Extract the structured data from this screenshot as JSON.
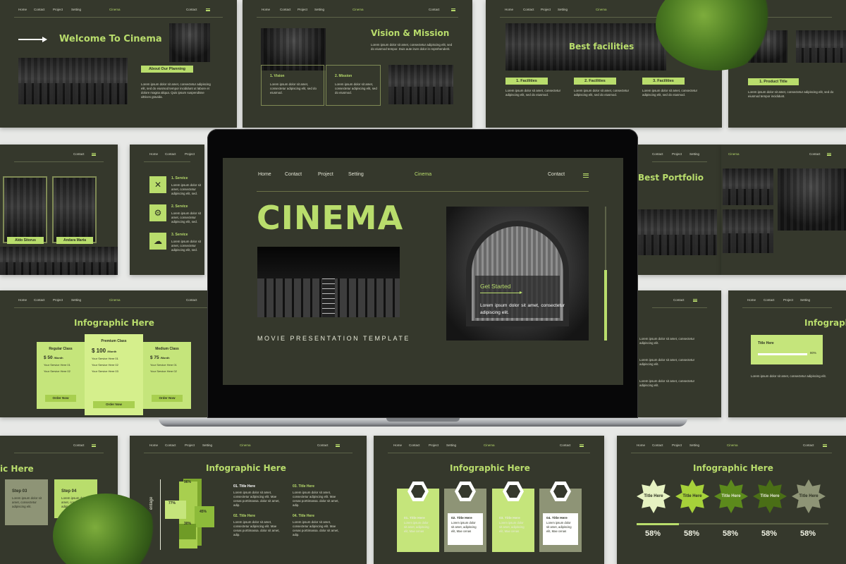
{
  "nav": {
    "home": "Home",
    "contact": "Contact",
    "project": "Project",
    "setting": "Setting",
    "brand": "Cinema",
    "contact_right": "Contact"
  },
  "slide_welcome": {
    "title": "Welcome To Cinema",
    "label": "About Our Planning",
    "text": "Lorem ipsum dolor sit amet, consectetur adipiscing elit, sed do eiusmod tempor incididunt ut labore et dolore magna aliqua. Quis ipsum suspendisse ultrices gravida."
  },
  "slide_vision": {
    "title": "Vision & Mission",
    "intro": "Lorem ipsum dolor sit amet, consectetur adipiscing elit, sed do eiusmod tempor. Duis aute irure dolor in reprehenderit.",
    "box1_title": "1. Vision",
    "box2_title": "2. Mission",
    "box_text": "Lorem ipsum dolor sit amet, consectetur adipiscing elit, sed do eiusmod."
  },
  "slide_facilities": {
    "title": "Best facilities",
    "items": [
      "1. Facilities",
      "2. Facilities",
      "3. Facilities"
    ],
    "text": "Lorem ipsum dolor sit amet, consectetur adipiscing elit, sed do eiusmod."
  },
  "slide_product": {
    "label": "1. Product Title",
    "text": "Lorem ipsum dolor sit amet, consectetur adipiscing elit, sed do eiusmod tempor incididunt."
  },
  "slide_team": {
    "names": [
      "Aldo Sitorus",
      "Andara Marta"
    ]
  },
  "slide_service": {
    "items": [
      "1. Service",
      "2. Service",
      "3. Service"
    ],
    "text": "Lorem ipsum dolor sit amet, consectetur adipiscing elit, sed."
  },
  "slide_portfolio": {
    "title": "Best Portfolio"
  },
  "slide_pricing": {
    "title": "Infographic Here",
    "plans": [
      {
        "name": "Regular Class",
        "price": "$ 50",
        "per": "/Month",
        "items": [
          "Your Service Here 01",
          "Your Service Here 02"
        ],
        "button": "Order Now"
      },
      {
        "name": "Premium Class",
        "price": "$ 100",
        "per": "/Month",
        "items": [
          "Your Service Here 01",
          "Your Service Here 02",
          "Your Service Here 03"
        ],
        "button": "Order Now"
      },
      {
        "name": "Medium Class",
        "price": "$ 75",
        "per": "/Month",
        "items": [
          "Your Service Here 01",
          "Your Service Here 02"
        ],
        "button": "Order Now"
      }
    ]
  },
  "slide_infographic_right": {
    "title": "Infographic",
    "card_title": "Title Here",
    "card_pct": "80%",
    "text": "Lorem ipsum dolor sit amet, consectetur adipiscing elit."
  },
  "slide_steps": {
    "title": "ic Here",
    "step3": "Step 03",
    "step4": "Step 04",
    "text": "Lorem ipsum dolor sit amet, consectetur adipiscing elit."
  },
  "slide_cube": {
    "title": "Infographic Here",
    "percents": [
      "96%",
      "77%",
      "45%",
      "30%"
    ],
    "axis": "entage",
    "items": [
      "01. Title Here",
      "02. Title Here",
      "03. Title Here",
      "04. Title Here"
    ],
    "text": "Lorem ipsum dolor sit amet, consectetur adipiscing elit. Mae cenas porttimassa. dolor sit amet, adip."
  },
  "slide_hex": {
    "title": "Infographic Here",
    "cards": [
      {
        "title": "01. Title Here",
        "text": "Lorem ipsum dolor sit amet, adipiscing elit, Mae cenas"
      },
      {
        "title": "02. Title Here",
        "text": "Lorem ipsum dolor sit amet, adipiscing elit, Mae cenas"
      },
      {
        "title": "03. Title Here",
        "text": "Lorem ipsum dolor sit amet, adipiscing elit, Mae cenas"
      },
      {
        "title": "04. Title Here",
        "text": "Lorem ipsum dolor sit amet, adipiscing elit, Mae cenas"
      }
    ]
  },
  "slide_stars": {
    "title": "Infographic Here",
    "star_label": "Title Here",
    "values": [
      "58%",
      "58%",
      "58%",
      "58%",
      "58%"
    ],
    "colors": [
      "#e6f2c2",
      "#a6d13a",
      "#5c8a1c",
      "#4a6e16",
      "#8e9476"
    ]
  },
  "main_screen": {
    "nav": {
      "home": "Home",
      "contact": "Contact",
      "project": "Project",
      "setting": "Setting",
      "brand": "Cinema",
      "contact_right": "Contact"
    },
    "title": "CINEMA",
    "subtitle": "MOVIE PRESENTATION TEMPLATE",
    "cta": "Get Started",
    "cta_text": "Lorem ipsum dolor sit amet, consectetur adipiscing elit."
  },
  "colors": {
    "background": "#35382c",
    "accent": "#b9dd6c",
    "page": "#e7e8e6"
  }
}
